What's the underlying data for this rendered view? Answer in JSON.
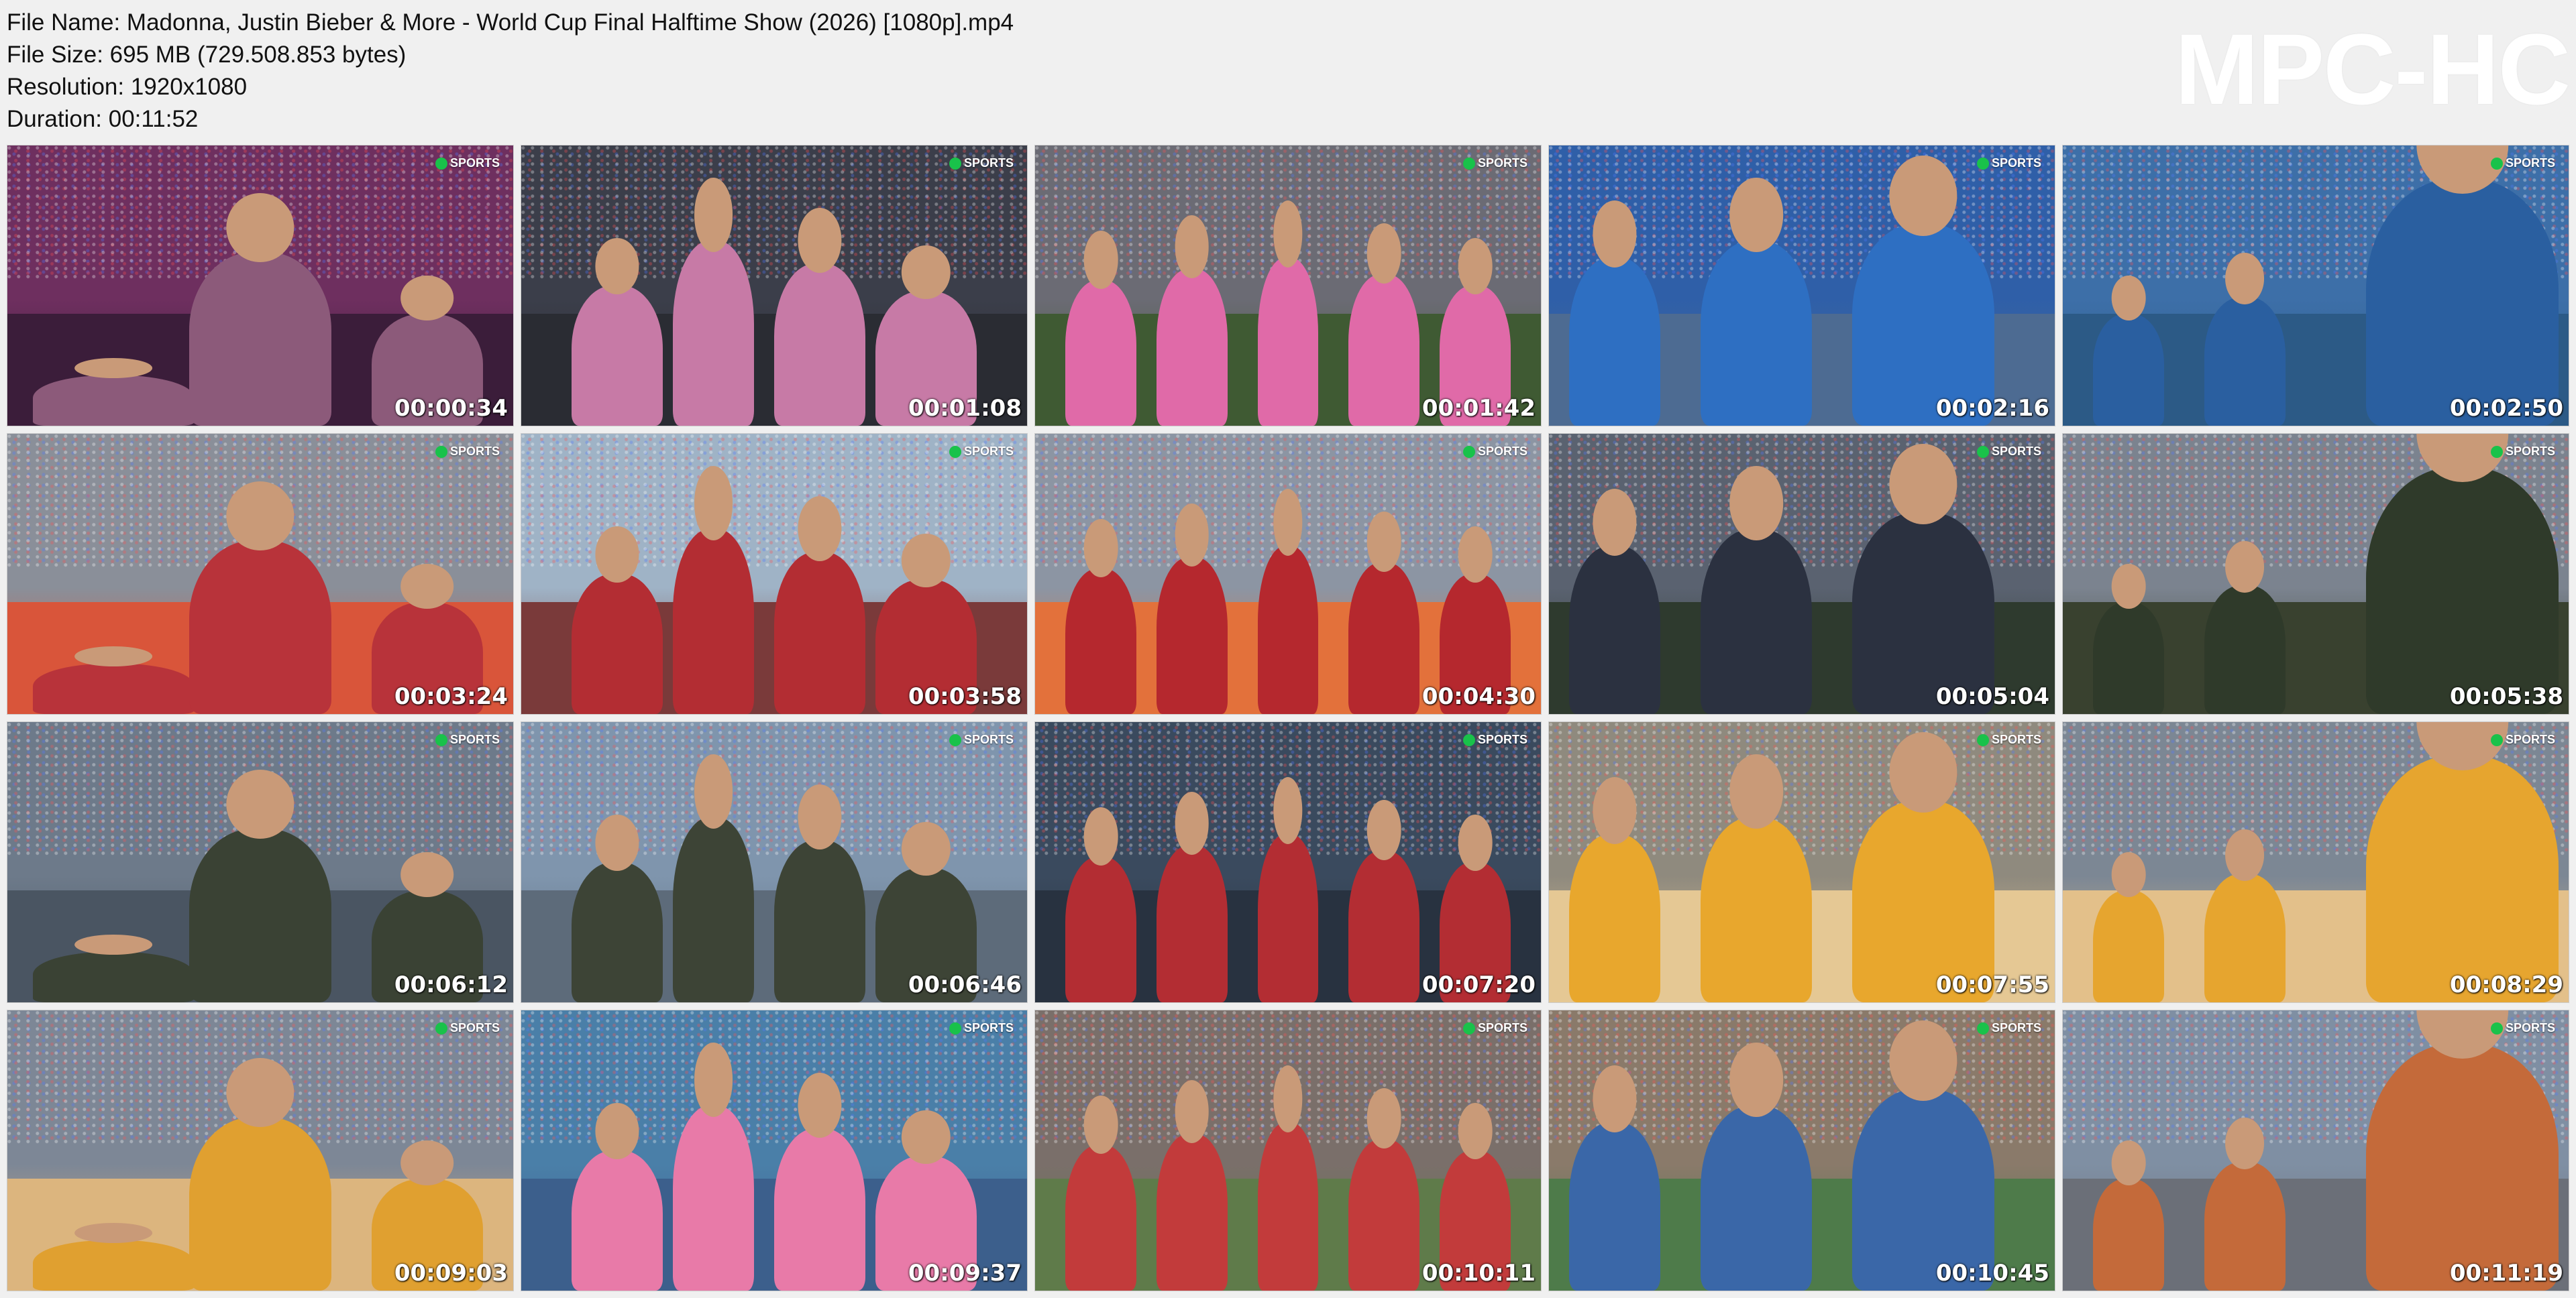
{
  "header": {
    "file_name": "File Name: Madonna, Justin Bieber & More - World Cup Final Halftime Show (2026) [1080p].mp4",
    "file_size": "File Size: 695 MB (729.508.853 bytes)",
    "resolution": "Resolution: 1920x1080",
    "duration": "Duration: 00:11:52",
    "brand": "MPC-HC"
  },
  "logo_text": "SPORTS",
  "thumbnails": [
    {
      "time": "00:00:34",
      "bg": "#6e2f5f",
      "field": "#3b1d3a",
      "fig": "#8c5a7a",
      "icon": "tv-sports-icon"
    },
    {
      "time": "00:01:08",
      "bg": "#3b3e4a",
      "field": "#2a2c33",
      "fig": "#c77aa6",
      "icon": "tv-sports-icon"
    },
    {
      "time": "00:01:42",
      "bg": "#6b6b74",
      "field": "#3f5a33",
      "fig": "#e06aa8",
      "icon": "tv-sports-icon"
    },
    {
      "time": "00:02:16",
      "bg": "#2f5fa8",
      "field": "#4d6b92",
      "fig": "#2e6fc2",
      "icon": "tv-sports-icon"
    },
    {
      "time": "00:02:50",
      "bg": "#3d6fa8",
      "field": "#2c5a86",
      "fig": "#2a5fa0",
      "icon": "tv-sports-icon"
    },
    {
      "time": "00:03:24",
      "bg": "#8a8f99",
      "field": "#d9553a",
      "fig": "#b8333a",
      "icon": "tv-sports-icon"
    },
    {
      "time": "00:03:58",
      "bg": "#9fb3c6",
      "field": "#7a3a3a",
      "fig": "#b32d33",
      "icon": "tv-sports-icon"
    },
    {
      "time": "00:04:30",
      "bg": "#8c95a3",
      "field": "#e3713b",
      "fig": "#b5282e",
      "icon": "tv-sports-icon"
    },
    {
      "time": "00:05:04",
      "bg": "#5a6270",
      "field": "#2e3a2e",
      "fig": "#2b3140",
      "icon": "tv-sports-icon"
    },
    {
      "time": "00:05:38",
      "bg": "#7b838f",
      "field": "#39412f",
      "fig": "#2f3a2a",
      "icon": "tv-sports-icon"
    },
    {
      "time": "00:06:12",
      "bg": "#6d7a8a",
      "field": "#4a5562",
      "fig": "#3a4234",
      "icon": "tv-sports-icon"
    },
    {
      "time": "00:06:46",
      "bg": "#7f95ad",
      "field": "#5d6b7a",
      "fig": "#3d4436",
      "icon": "tv-sports-icon"
    },
    {
      "time": "00:07:20",
      "bg": "#3a4a5e",
      "field": "#283240",
      "fig": "#b32d33",
      "icon": "tv-sports-icon"
    },
    {
      "time": "00:07:55",
      "bg": "#8f8a7e",
      "field": "#e5c894",
      "fig": "#e8a72d",
      "icon": "tv-sports-icon"
    },
    {
      "time": "00:08:29",
      "bg": "#7c8794",
      "field": "#e3c08a",
      "fig": "#e6a52f",
      "icon": "tv-sports-icon"
    },
    {
      "time": "00:09:03",
      "bg": "#7d8796",
      "field": "#dcb57e",
      "fig": "#e0a030",
      "icon": "tv-sports-icon"
    },
    {
      "time": "00:09:37",
      "bg": "#4a7fa8",
      "field": "#3c5f8c",
      "fig": "#e87aa8",
      "icon": "tv-sports-icon"
    },
    {
      "time": "00:10:11",
      "bg": "#7a6f6a",
      "field": "#5f7b4a",
      "fig": "#c23b3b",
      "icon": "tv-sports-icon"
    },
    {
      "time": "00:10:45",
      "bg": "#8a7a6a",
      "field": "#4e7b4a",
      "fig": "#3a67a8",
      "icon": "tv-sports-icon"
    },
    {
      "time": "00:11:19",
      "bg": "#7f8fa3",
      "field": "#6b6f78",
      "fig": "#c46a3a",
      "icon": "tv-sports-icon"
    }
  ]
}
